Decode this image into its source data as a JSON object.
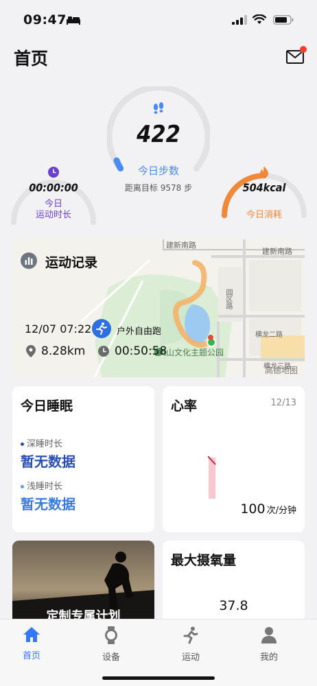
{
  "status_bar": {
    "time": "09:47"
  },
  "header": {
    "title": "首页"
  },
  "steps": {
    "value": "422",
    "label": "今日步数",
    "target_text": "距离目标 9578 步",
    "progress": 0.042
  },
  "duration": {
    "value": "00:00:00",
    "label_line1": "今日",
    "label_line2": "运动时长",
    "progress": 0.0
  },
  "calories": {
    "value": "504kcal",
    "label": "今日消耗",
    "progress": 0.55
  },
  "workout": {
    "title": "运动记录",
    "datetime": "12/07 07:22",
    "type": "户外自由跑",
    "distance": "8.28km",
    "elapsed": "00:50:58",
    "map_labels": {
      "road1": "建新南路",
      "road2": "建新南路",
      "road3": "横龙二路",
      "road4": "横龙三路",
      "road5": "园区路",
      "park": "飞凤山文化主题公园",
      "watermark": "高德地图"
    }
  },
  "sleep": {
    "title": "今日睡眠",
    "deep_label": "深睡时长",
    "deep_value": "暂无数据",
    "light_label": "浅睡时长",
    "light_value": "暂无数据"
  },
  "heart": {
    "title": "心率",
    "date": "12/13",
    "value": "100",
    "unit": "次/分钟"
  },
  "plan": {
    "title": "定制专属计划"
  },
  "vo2": {
    "title": "最大摄氧量",
    "value": "37.8"
  },
  "tabs": [
    {
      "label": "首页",
      "icon": "home-icon",
      "active": true
    },
    {
      "label": "设备",
      "icon": "watch-icon",
      "active": false
    },
    {
      "label": "运动",
      "icon": "run-icon",
      "active": false
    },
    {
      "label": "我的",
      "icon": "person-icon",
      "active": false
    }
  ],
  "colors": {
    "accent": "#3478f6",
    "calories": "#f0883a",
    "duration": "#6b3fd4",
    "heart_bar": "#f7c8cf",
    "heart_line": "#c0283a"
  }
}
